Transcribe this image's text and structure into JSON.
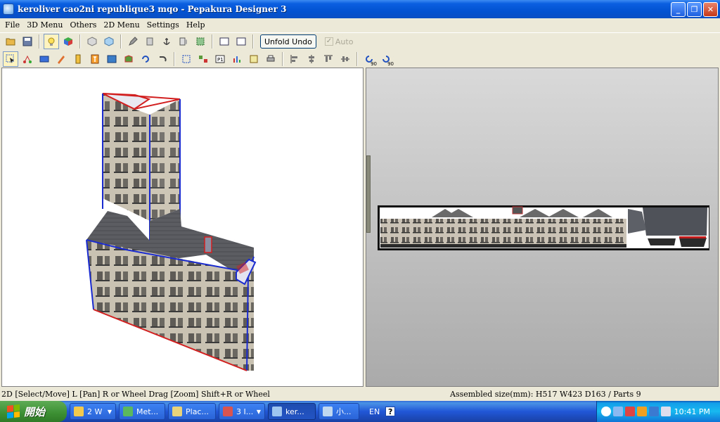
{
  "window": {
    "title": "keroliver cao2ni republique3 mqo - Pepakura Designer 3",
    "controls": {
      "minimize": "_",
      "maximize": "❐",
      "close": "✕"
    }
  },
  "menu": [
    "File",
    "3D Menu",
    "Others",
    "2D Menu",
    "Settings",
    "Help"
  ],
  "toolbar": {
    "unfold_undo_label": "Unfold Undo",
    "auto_label": "Auto",
    "auto_checked": true,
    "rotate_ccw_label": "90",
    "rotate_cw_label": "90"
  },
  "status": {
    "left": "2D [Select/Move] L [Pan] R or Wheel Drag [Zoom] Shift+R or Wheel",
    "right": "Assembled size(mm): H517 W423 D163 / Parts 9"
  },
  "taskbar": {
    "start_label": "開始",
    "tasks": [
      {
        "label": "2 W",
        "color": "#f2c94c",
        "has_arrow": true
      },
      {
        "label": "Met...",
        "color": "#5cb85c",
        "has_arrow": false
      },
      {
        "label": "Plac...",
        "color": "#e8d27a",
        "has_arrow": false
      },
      {
        "label": "3 I...",
        "color": "#d9534f",
        "has_arrow": true
      },
      {
        "label": "ker...",
        "color": "#9ec5f0",
        "has_arrow": false,
        "active": true
      },
      {
        "label": "小...",
        "color": "#c0d8f0",
        "has_arrow": false
      }
    ],
    "language": "EN",
    "help": "?",
    "clock": "10:41 PM"
  }
}
